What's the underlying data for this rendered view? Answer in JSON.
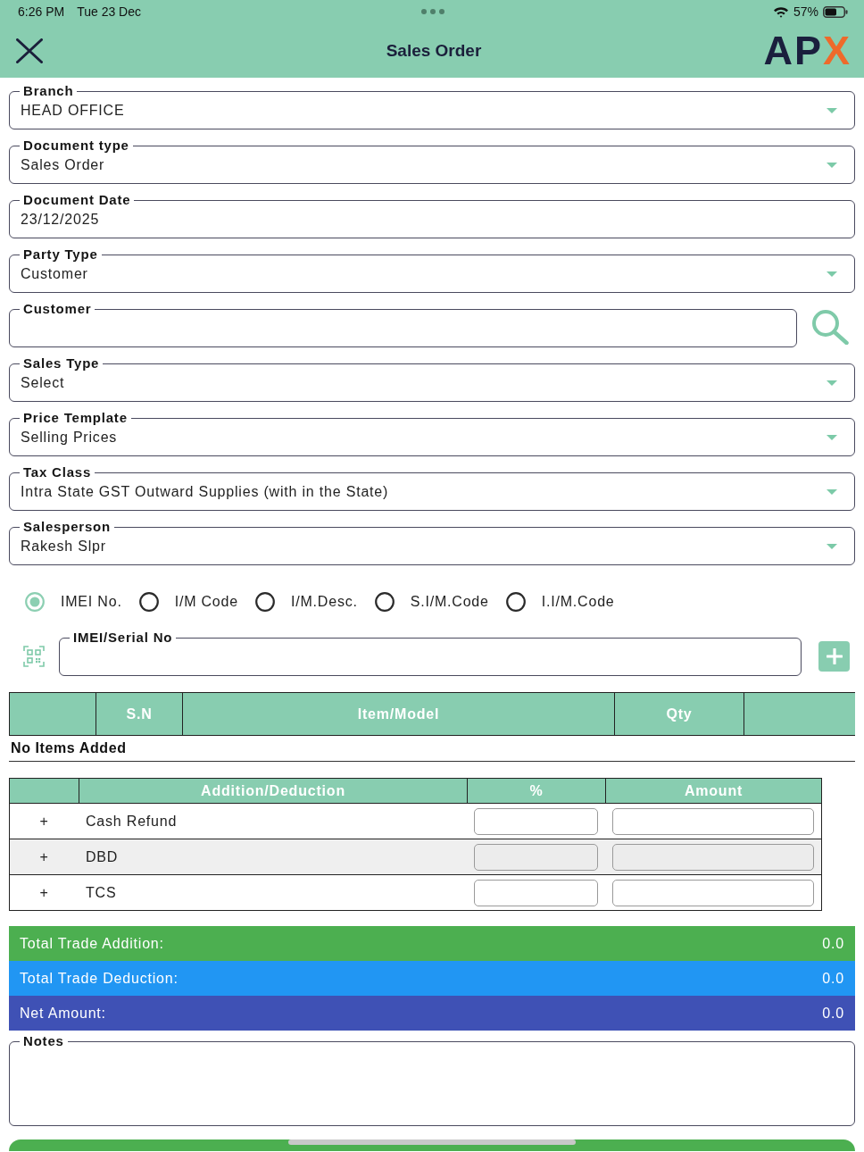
{
  "status_bar": {
    "time": "6:26 PM",
    "date": "Tue 23 Dec",
    "battery": "57%"
  },
  "header": {
    "title": "Sales Order",
    "logo": {
      "text": "AP",
      "accent": "X"
    }
  },
  "fields": [
    {
      "label": "Branch",
      "value": "HEAD OFFICE",
      "kind": "dropdown"
    },
    {
      "label": "Document type",
      "value": "Sales Order",
      "kind": "dropdown"
    },
    {
      "label": "Document Date",
      "value": "23/12/2025",
      "kind": "text"
    },
    {
      "label": "Party Type",
      "value": "Customer",
      "kind": "dropdown"
    },
    {
      "label": "Customer",
      "kind": "search"
    },
    {
      "label": "Sales Type",
      "value": "Select",
      "kind": "dropdown"
    },
    {
      "label": "Price Template",
      "value": "Selling Prices",
      "kind": "dropdown"
    },
    {
      "label": "Tax Class",
      "value": "Intra State GST Outward Supplies (with in the State)",
      "kind": "dropdown"
    },
    {
      "label": "Salesperson",
      "value": "Rakesh Slpr",
      "kind": "dropdown"
    }
  ],
  "search_mode": {
    "options": [
      {
        "label": "IMEI No.",
        "selected": true
      },
      {
        "label": "I/M Code",
        "selected": false
      },
      {
        "label": "I/M.Desc.",
        "selected": false
      },
      {
        "label": "S.I/M.Code",
        "selected": false
      },
      {
        "label": "I.I/M.Code",
        "selected": false
      }
    ]
  },
  "serial_field": {
    "label": "IMEI/Serial No"
  },
  "items_table": {
    "columns": [
      "S.N",
      "Item/Model",
      "Qty"
    ],
    "empty_message": "No Items Added"
  },
  "adjustments": {
    "columns": [
      "Addition/Deduction",
      "%",
      "Amount"
    ],
    "rows": [
      {
        "sign": "+",
        "name": "Cash Refund",
        "disabled": false
      },
      {
        "sign": "+",
        "name": "DBD",
        "disabled": true
      },
      {
        "sign": "+",
        "name": "TCS",
        "disabled": false
      }
    ]
  },
  "totals": [
    {
      "label": "Total Trade Addition:",
      "value": "0.0",
      "color": "#4caf50"
    },
    {
      "label": "Total Trade Deduction:",
      "value": "0.0",
      "color": "#2196f3"
    },
    {
      "label": "Net Amount:",
      "value": "0.0",
      "color": "#3f51b5"
    }
  ],
  "notes": {
    "label": "Notes"
  }
}
